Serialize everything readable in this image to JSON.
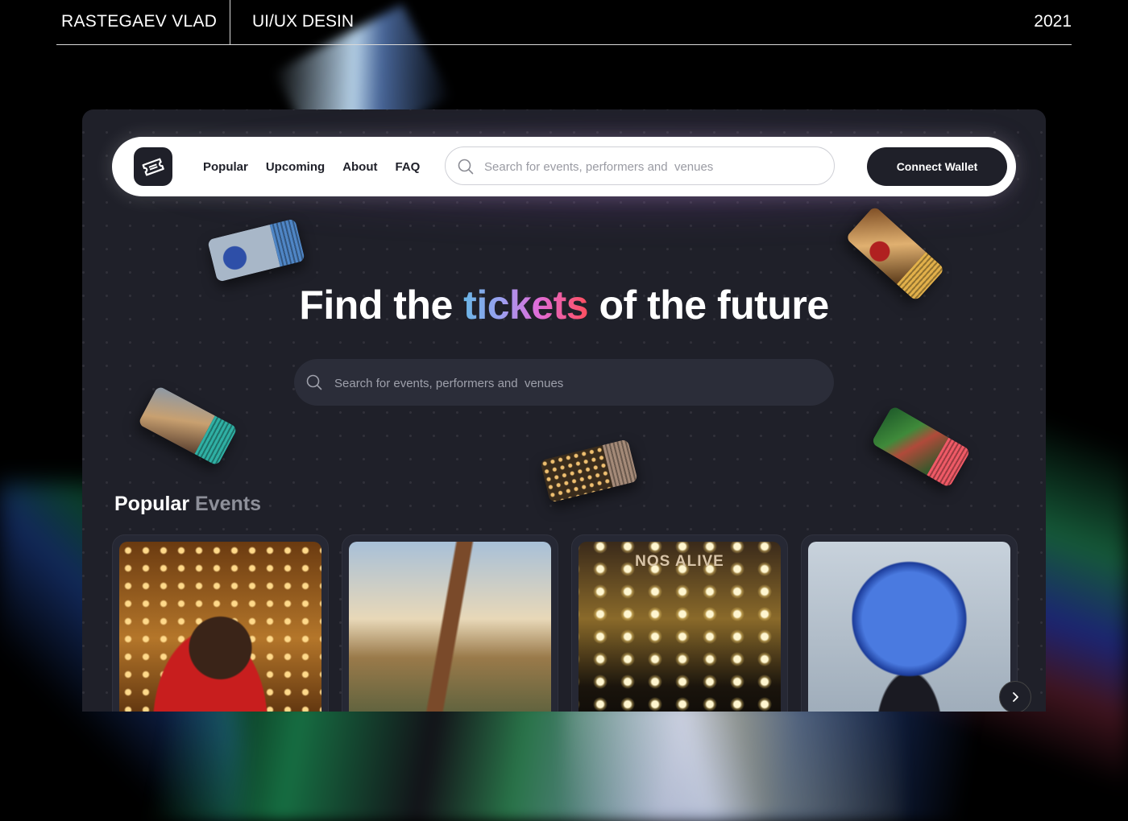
{
  "header": {
    "author": "RASTEGAEV VLAD",
    "subtitle": "UI/UX DESIN",
    "year": "2021"
  },
  "nav": {
    "links": [
      "Popular",
      "Upcoming",
      "About",
      "FAQ"
    ],
    "search_placeholder": "Search for events, performers and  venues",
    "connect_label": "Connect Wallet"
  },
  "hero": {
    "title_before": "Find the ",
    "title_highlight": "tickets",
    "title_after": " of the future",
    "search_placeholder": "Search for events, performers and  venues"
  },
  "popular": {
    "title_primary": "Popular",
    "title_secondary": "Events",
    "cards": [
      {
        "image": "performer-red-jacket"
      },
      {
        "image": "festival-crowd-stage"
      },
      {
        "image": "concert-stage-lights",
        "sign": "NOS ALIVE"
      },
      {
        "image": "globe-trophy"
      }
    ]
  },
  "icons": {
    "logo": "ticket-icon",
    "search": "search-icon",
    "next": "chevron-right-icon"
  },
  "colors": {
    "app_bg": "#1f2029",
    "nav_bg": "#ffffff",
    "button_bg": "#1f2029",
    "gradient_start": "#6ab6e6",
    "gradient_end": "#ff4f5e"
  }
}
